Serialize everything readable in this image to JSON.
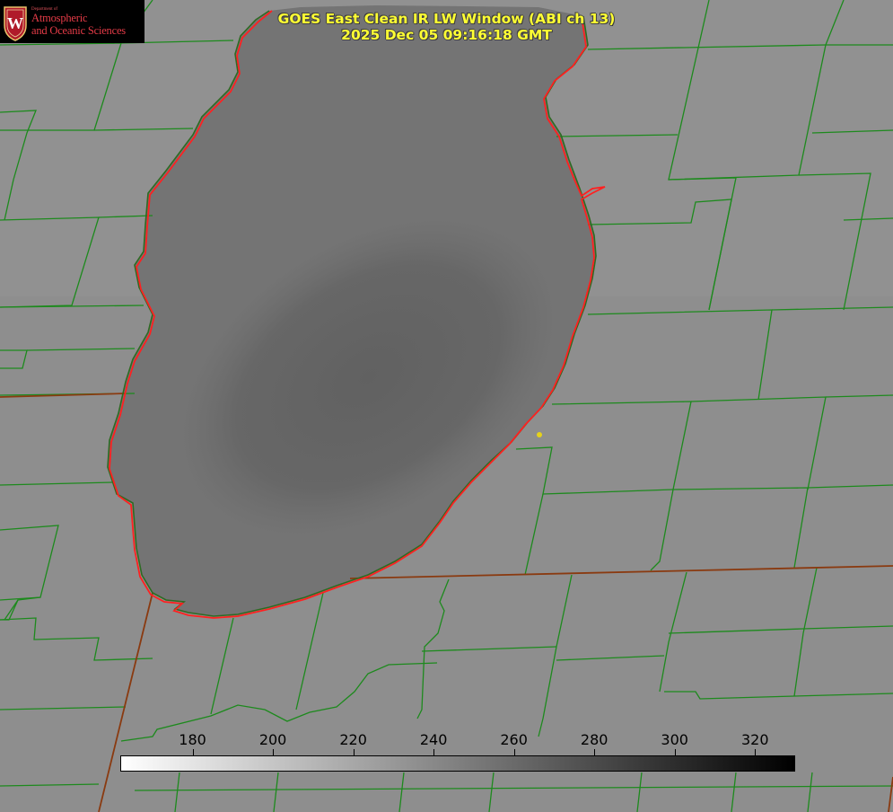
{
  "title": {
    "line1": "GOES East Clean IR LW Window (ABI ch 13)",
    "line2": "2025 Dec 05 09:16:18 GMT"
  },
  "logo": {
    "dept": "Department of",
    "line1": "Atmospheric",
    "line2": "and Oceanic Sciences",
    "crest_letter": "W",
    "colors": {
      "background": "#000000",
      "text": "#e53b47",
      "crest": "#b01a2a"
    }
  },
  "colorbar": {
    "unit": "",
    "range": [
      162,
      330
    ],
    "gradient": {
      "low_color": "#ffffff",
      "high_color": "#000000"
    },
    "ticks": [
      {
        "value": 180,
        "label": "180"
      },
      {
        "value": 200,
        "label": "200"
      },
      {
        "value": 220,
        "label": "220"
      },
      {
        "value": 240,
        "label": "240"
      },
      {
        "value": 260,
        "label": "260"
      },
      {
        "value": 280,
        "label": "280"
      },
      {
        "value": 300,
        "label": "300"
      },
      {
        "value": 320,
        "label": "320"
      }
    ]
  },
  "map": {
    "land_color": "#8e8e8e",
    "lake_color": "#6a6a6a",
    "lake_cold_core_color": "#636363",
    "shoreline_colors": [
      "#ff2020",
      "#2e6a22"
    ],
    "county_line_color": "#1d8a1d",
    "state_line_color": "#8a3a10",
    "marker_color": "#e6d21a"
  }
}
